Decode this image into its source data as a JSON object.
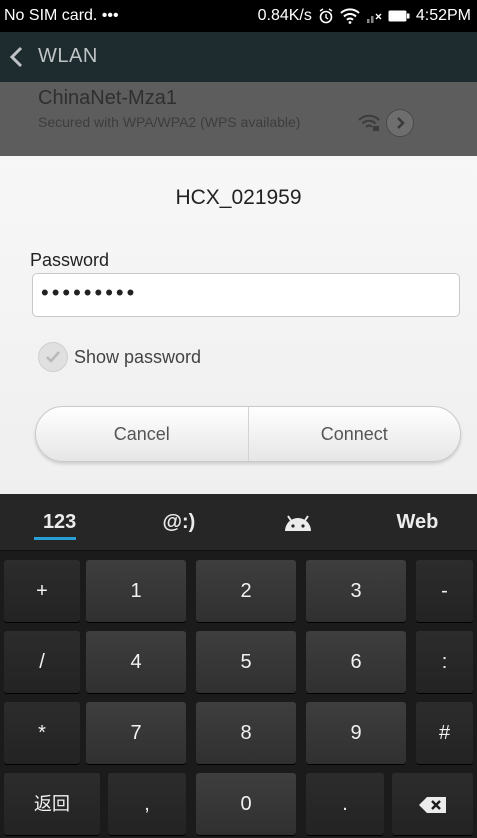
{
  "status_bar": {
    "carrier": "No SIM card. •••",
    "speed": "0.84K/s",
    "time": "4:52PM",
    "icons": [
      "alarm-icon",
      "wifi-icon",
      "signal-icon",
      "battery-icon"
    ]
  },
  "action_bar": {
    "back_icon": "chevron-left-icon",
    "title": "WLAN"
  },
  "network_row": {
    "name": "ChinaNet-Mza1",
    "subtitle": "Secured with WPA/WPA2 (WPS available)"
  },
  "dialog": {
    "title": "HCX_021959",
    "password_label": "Password",
    "password_value": "•••••••••",
    "show_password_label": "Show password",
    "cancel_label": "Cancel",
    "connect_label": "Connect"
  },
  "keyboard": {
    "tabs": [
      "123",
      "@:)",
      "android-icon",
      "Web"
    ],
    "active_tab": "123",
    "rows": [
      [
        "+",
        "1",
        "2",
        "3",
        "-"
      ],
      [
        "/",
        "4",
        "5",
        "6",
        ":"
      ],
      [
        "*",
        "7",
        "8",
        "9",
        "#"
      ],
      [
        "返回",
        ",",
        "0",
        ".",
        "backspace-icon"
      ]
    ]
  },
  "colors": {
    "accent": "#2a9fd6",
    "dialog_bg": "#f4f4f4",
    "keyboard_bg": "#1b1b1b"
  }
}
